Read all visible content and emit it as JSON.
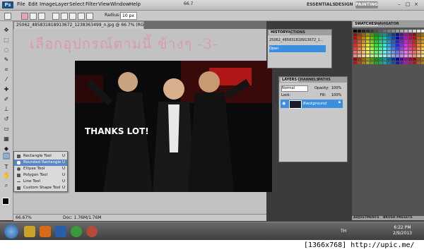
{
  "app": {
    "logo": "Ps"
  },
  "menu": [
    "File",
    "Edit",
    "Image",
    "Layer",
    "Select",
    "Filter",
    "View",
    "Window",
    "Help"
  ],
  "zoom_field": "66.7",
  "workspaces": [
    "ESSENTIALS",
    "DESIGN",
    "PAINTING"
  ],
  "options": {
    "radius_label": "Radius:",
    "radius_value": "10 px"
  },
  "document": {
    "tab_title": "25062_485831818913672_1238363499_n.jpg @ 66.7% (RGB/8)",
    "annotation_text": "เลือกอุปกรณ์ตามนี้ ข้างๆ  -3-",
    "zoom": "66.67%",
    "doc_size": "Doc: 1.76M/1.76M",
    "photo_caption": "THANKS LOT!"
  },
  "shape_flyout": [
    {
      "label": "Rectangle Tool",
      "key": "U",
      "selected": false
    },
    {
      "label": "Rounded Rectangle Tool",
      "key": "U",
      "selected": true
    },
    {
      "label": "Ellipse Tool",
      "key": "U",
      "selected": false
    },
    {
      "label": "Polygon Tool",
      "key": "U",
      "selected": false
    },
    {
      "label": "Line Tool",
      "key": "U",
      "selected": false
    },
    {
      "label": "Custom Shape Tool",
      "key": "U",
      "selected": false
    }
  ],
  "history": {
    "tabs": [
      "HISTORY",
      "ACTIONS"
    ],
    "rows": [
      "25062_485831818913672_1...",
      "Open"
    ]
  },
  "layers": {
    "tabs": [
      "LAYERS",
      "CHANNELS",
      "PATHS"
    ],
    "blend": "Normal",
    "opacity_label": "Opacity:",
    "opacity": "100%",
    "lock_label": "Lock:",
    "fill_label": "Fill:",
    "fill": "100%",
    "layer_name": "Background"
  },
  "swatches": {
    "tabs": [
      "SWATCHES",
      "NAVIGATOR"
    ]
  },
  "dock_bottom": {
    "tabs": [
      "ADJUSTMENTS",
      "BRUSH PRESETS"
    ]
  },
  "taskbar": {
    "time": "6:22 PM",
    "date": "2/9/2013",
    "lang": "TH"
  },
  "footer": {
    "watermark": "[1366x768] http://upic.me/"
  },
  "colors": {
    "accent": "#3a8fe0",
    "annotation": "#d99ab4"
  }
}
